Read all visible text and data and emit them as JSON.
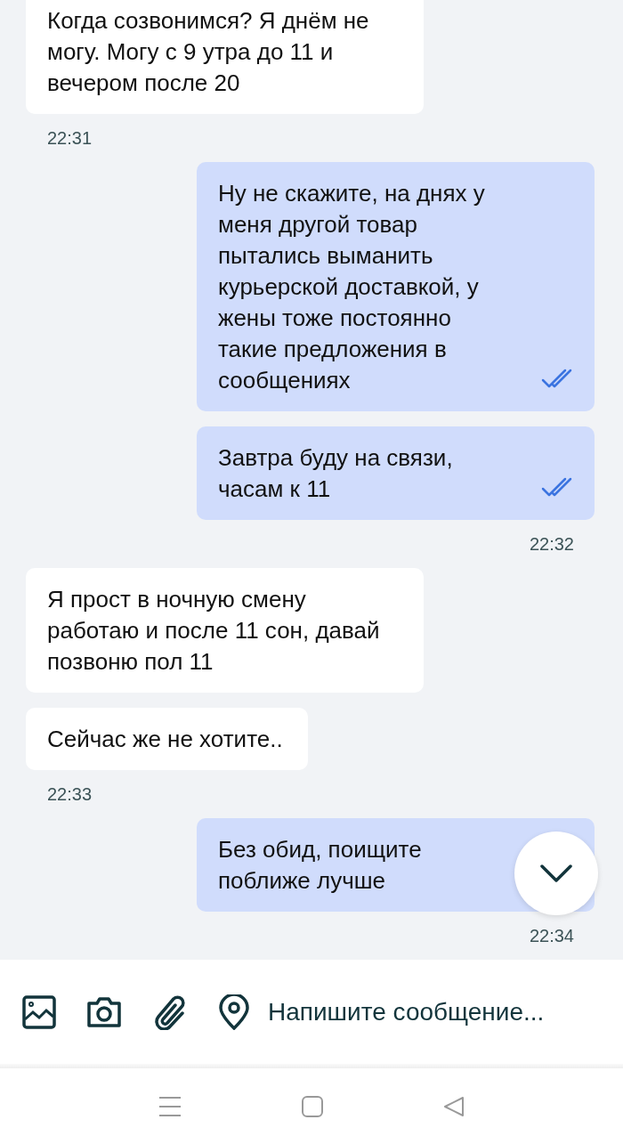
{
  "messages": [
    {
      "kind": "incoming",
      "text": "Когда созвонимся? Я днём не могу. Могу с 9 утра до 11 и вечером после 20"
    },
    {
      "kind": "incoming_time",
      "text": "22:31"
    },
    {
      "kind": "outgoing",
      "text": "Ну не скажите, на днях у меня другой товар пытались выманить курьерской доставкой, у жены тоже постоянно такие предложения в сообщениях",
      "read": true
    },
    {
      "kind": "outgoing",
      "text": "Завтра буду на связи, часам к 11",
      "read": true
    },
    {
      "kind": "outgoing_time",
      "text": "22:32"
    },
    {
      "kind": "incoming",
      "text": "Я прост в ночную смену работаю и после 11 сон, давай позвоню пол 11"
    },
    {
      "kind": "incoming",
      "text": "Сейчас же не хотите.."
    },
    {
      "kind": "incoming_time",
      "text": "22:33"
    },
    {
      "kind": "outgoing",
      "text": "Без обид, поищите поближе лучше"
    },
    {
      "kind": "outgoing_time",
      "text": "22:34"
    }
  ],
  "composer": {
    "placeholder": "Напишите сообщение..."
  }
}
